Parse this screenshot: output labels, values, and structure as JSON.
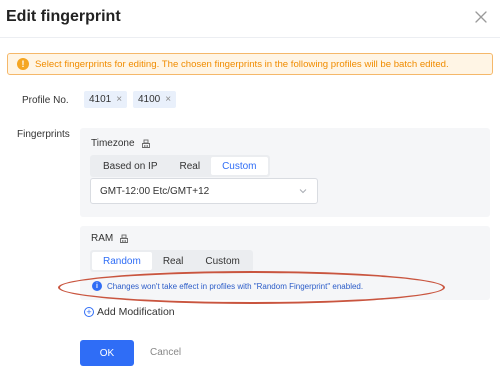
{
  "dialog": {
    "title": "Edit fingerprint",
    "close_icon": "close-icon"
  },
  "alert": {
    "icon": "warning-icon",
    "icon_glyph": "!",
    "text": "Select fingerprints for editing. The chosen fingerprints in the following profiles will be batch edited.",
    "color": "#f08c00"
  },
  "profile": {
    "label": "Profile No.",
    "tags": [
      {
        "label": "4101",
        "remove": "×"
      },
      {
        "label": "4100",
        "remove": "×"
      }
    ]
  },
  "fingerprints": {
    "label": "Fingerprints",
    "timezone": {
      "title": "Timezone",
      "clear_icon": "eraser-icon",
      "options": [
        "Based on IP",
        "Real",
        "Custom"
      ],
      "selected": "Custom",
      "select_value": "GMT-12:00 Etc/GMT+12"
    },
    "ram": {
      "title": "RAM",
      "clear_icon": "eraser-icon",
      "options": [
        "Random",
        "Real",
        "Custom"
      ],
      "selected": "Random",
      "info_glyph": "i",
      "info_text": "Changes won't take effect in profiles with \"Random Fingerprint\" enabled."
    }
  },
  "add_modification": {
    "icon": "plus-circle-icon",
    "glyph": "+",
    "label": "Add Modification"
  },
  "footer": {
    "ok_label": "OK",
    "cancel_label": "Cancel"
  },
  "colors": {
    "accent": "#2f6df6",
    "annotation": "#c9553f"
  }
}
